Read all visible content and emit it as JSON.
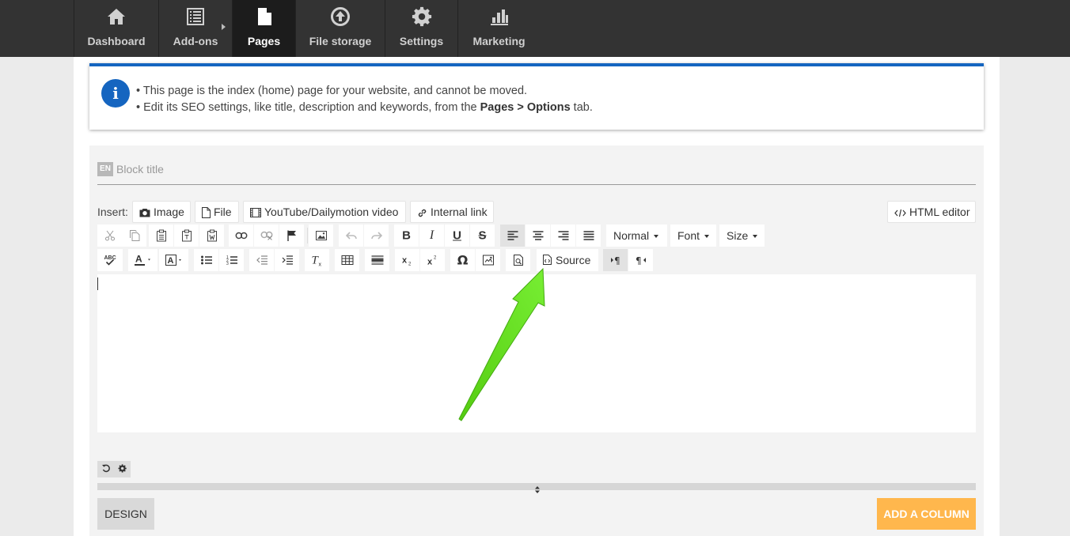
{
  "nav": {
    "items": [
      {
        "label": "Dashboard",
        "icon": "home-icon"
      },
      {
        "label": "Add-ons",
        "icon": "list-icon"
      },
      {
        "label": "Pages",
        "icon": "page-icon",
        "active": true
      },
      {
        "label": "File storage",
        "icon": "upload-circle-icon"
      },
      {
        "label": "Settings",
        "icon": "gear-icon"
      },
      {
        "label": "Marketing",
        "icon": "bar-chart-icon"
      }
    ]
  },
  "info": {
    "line1": "• This page is the index (home) page for your website, and cannot be moved.",
    "line2_prefix": "• Edit its SEO settings, like title, description and keywords, from the ",
    "line2_bold": "Pages > Options",
    "line2_suffix": " tab."
  },
  "block": {
    "lang_badge": "EN",
    "title_placeholder": "Block title"
  },
  "insert": {
    "label": "Insert:",
    "image": "Image",
    "file": "File",
    "video": "YouTube/Dailymotion video",
    "internal_link": "Internal link",
    "html_editor": "HTML editor"
  },
  "toolbar": {
    "format": "Normal",
    "font": "Font",
    "size": "Size",
    "source": "Source"
  },
  "footer": {
    "design": "DESIGN",
    "add_column": "ADD A COLUMN"
  },
  "colors": {
    "nav_bg": "#333333",
    "info_accent": "#1565c0",
    "add_column": "#ffb74d",
    "annotation_arrow": "#66dd22"
  }
}
